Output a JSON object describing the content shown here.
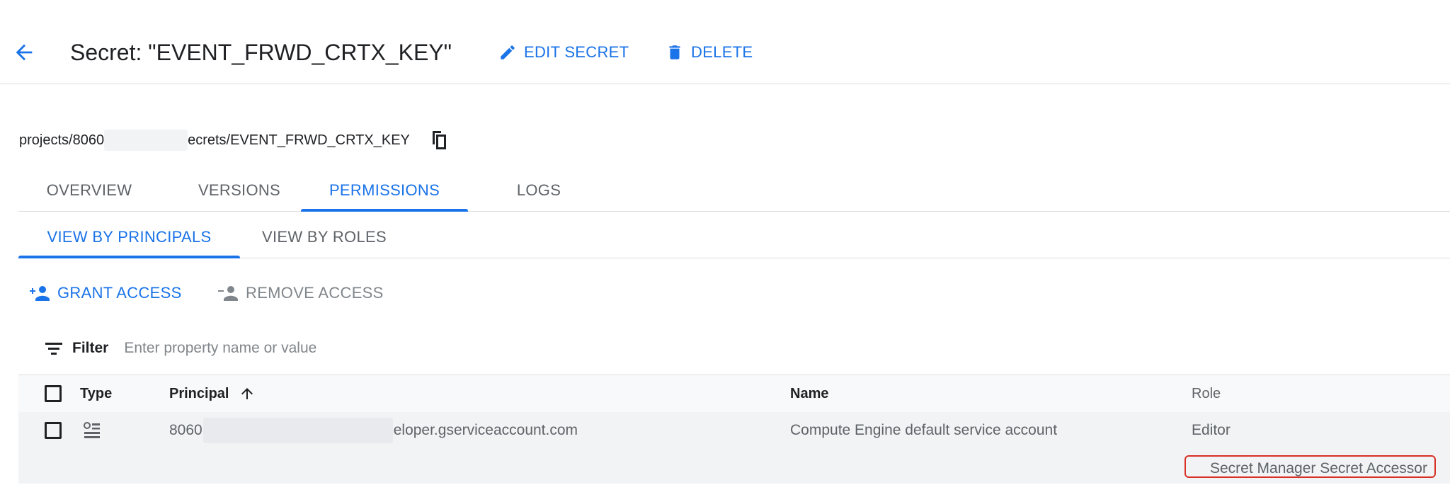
{
  "header": {
    "title": "Secret: \"EVENT_FRWD_CRTX_KEY\"",
    "back_icon": "arrow-back-icon",
    "edit_label": "EDIT SECRET",
    "edit_icon": "pencil-icon",
    "delete_label": "DELETE",
    "delete_icon": "trash-icon"
  },
  "resource": {
    "path_prefix": "projects/8060",
    "path_suffix": "ecrets/EVENT_FRWD_CRTX_KEY",
    "copy_icon": "copy-icon"
  },
  "tabs": [
    {
      "label": "OVERVIEW",
      "active": false
    },
    {
      "label": "VERSIONS",
      "active": false
    },
    {
      "label": "PERMISSIONS",
      "active": true
    },
    {
      "label": "LOGS",
      "active": false
    }
  ],
  "subtabs": [
    {
      "label": "VIEW BY PRINCIPALS",
      "active": true
    },
    {
      "label": "VIEW BY ROLES",
      "active": false
    }
  ],
  "actions": {
    "grant_label": "GRANT ACCESS",
    "remove_label": "REMOVE ACCESS"
  },
  "filter": {
    "label": "Filter",
    "placeholder": "Enter property name or value"
  },
  "table": {
    "columns": {
      "type": "Type",
      "principal": "Principal",
      "name": "Name",
      "role": "Role"
    },
    "sort_icon": "arrow-up-icon",
    "rows": [
      {
        "type_icon": "service-account-icon",
        "principal_prefix": "8060",
        "principal_suffix": "eloper.gserviceaccount.com",
        "name": "Compute Engine default service account",
        "roles": [
          "Editor",
          "Secret Manager Secret Accessor"
        ]
      }
    ]
  },
  "colors": {
    "accent": "#1a73e8",
    "highlight_border": "#d93025",
    "muted": "#5f6368"
  }
}
